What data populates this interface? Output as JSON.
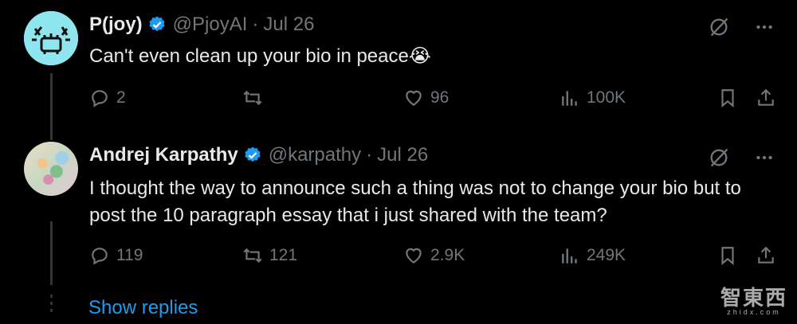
{
  "tweets": [
    {
      "name": "P(joy)",
      "handle": "@PjoyAI",
      "sep": "·",
      "date": "Jul 26",
      "text": "Can't even clean up your bio in peace😭",
      "replies": "2",
      "reposts": "",
      "likes": "96",
      "views": "100K"
    },
    {
      "name": "Andrej Karpathy",
      "handle": "@karpathy",
      "sep": "·",
      "date": "Jul 26",
      "text": "I thought the way to announce such a thing was not to change your bio but to post the 10 paragraph essay that i just shared with the team?",
      "replies": "119",
      "reposts": "121",
      "likes": "2.9K",
      "views": "249K"
    }
  ],
  "show_replies": "Show replies",
  "watermark": {
    "main": "智東西",
    "sub": "zhidx.com"
  },
  "colors": {
    "accent": "#1d9bf0",
    "muted": "#71767b",
    "text": "#e7e9ea",
    "bg": "#000000"
  }
}
